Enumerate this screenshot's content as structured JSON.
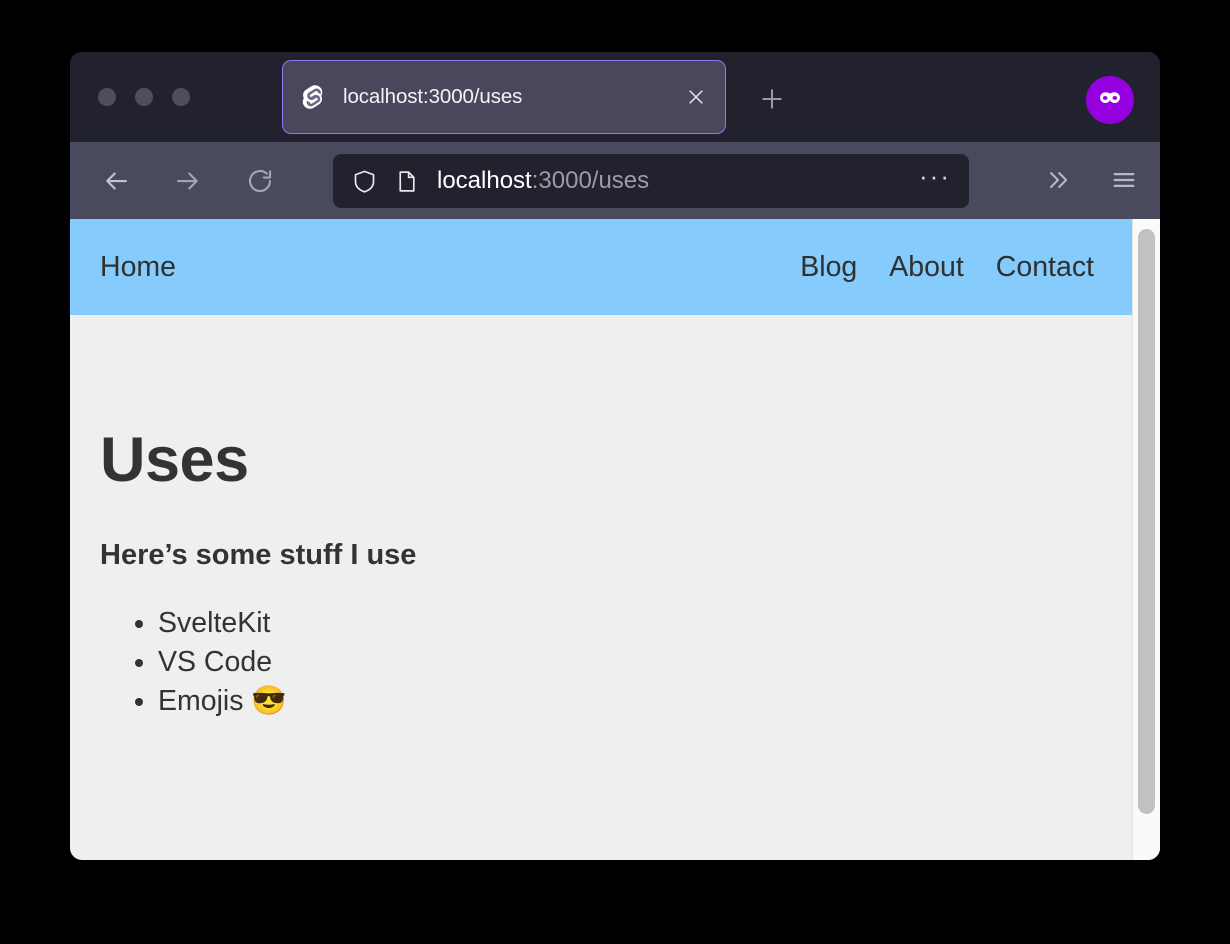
{
  "window": {
    "traffic_lights": [
      "close",
      "minimize",
      "maximize"
    ]
  },
  "browser": {
    "tab": {
      "favicon": "svelte-logo-icon",
      "title": "localhost:3000/uses",
      "close_label": "×"
    },
    "new_tab_label": "+",
    "privacy_badge": "private-browsing-mask-icon",
    "nav": {
      "back": "back-arrow-icon",
      "forward": "forward-arrow-icon",
      "reload": "reload-icon"
    },
    "urlbar": {
      "shield": "shield-icon",
      "page_icon": "page-document-icon",
      "url_host": "localhost",
      "url_rest": ":3000/uses",
      "more_label": "···"
    },
    "toolbar_right": {
      "overflow": "»",
      "menu": "hamburger-menu-icon"
    }
  },
  "site": {
    "nav": {
      "brand": "Home",
      "links": [
        "Blog",
        "About",
        "Contact"
      ]
    },
    "main": {
      "title": "Uses",
      "subtitle": "Here’s some stuff I use",
      "list": [
        "SvelteKit",
        "VS Code",
        "Emojis 😎"
      ]
    }
  },
  "colors": {
    "tabstrip_bg": "#22222e",
    "toolbar_bg": "#4a4a5e",
    "tab_bg": "#4a465c",
    "tab_border": "#8c7bf0",
    "urlbar_bg": "#22222e",
    "privacy_purple": "#9400e0",
    "site_nav_blue": "#85cbfb",
    "page_bg": "#efefef",
    "text_dark": "#333333",
    "scrollbar_thumb": "#c1c1c1"
  }
}
